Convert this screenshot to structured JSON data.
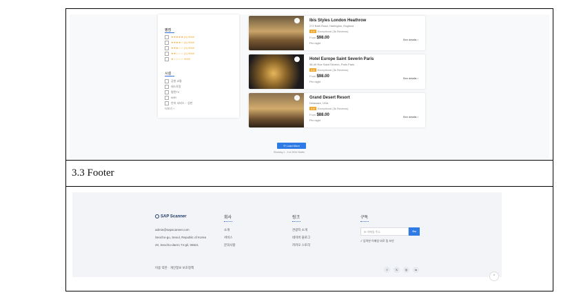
{
  "listing": {
    "filter_rating_title": "평점",
    "rating_items": [
      "★★★★★ (5) 9999",
      "★★★★☆ (4) 9999",
      "★★★☆☆ (3) 9999",
      "★★☆☆☆ (2) 9999",
      "★☆☆☆☆ 9999"
    ],
    "filter_facility_title": "시설",
    "facility_items": [
      "공항 교통",
      "레스토랑",
      "평면TV",
      "WiFi",
      "안마 서비스 ~ 상한"
    ],
    "facility_more": "더보기 +",
    "hotels": [
      {
        "name": "Ibis Styles London Heathrow",
        "address": "272 Bath Road, Harlington, England",
        "rating": "4.8",
        "rating_label": "Exceptional",
        "reviews": "(3k Reviews)",
        "price_prefix": "From",
        "price": "$98.00",
        "per": "Per night",
        "see": "See details ›"
      },
      {
        "name": "Hotel Europe Saint Severin Paris",
        "address": "38-40 Rue Saint Séverin, Paris Paris",
        "rating": "4.8",
        "rating_label": "Exceptional",
        "reviews": "(3k Reviews)",
        "price_prefix": "From",
        "price": "$98.00",
        "per": "Per night",
        "see": "See details ›"
      },
      {
        "name": "Grand Desert Resort",
        "address": "Delaware, USA",
        "rating": "4.8",
        "rating_label": "Exceptional",
        "reviews": "(3k Reviews)",
        "price_prefix": "From",
        "price": "$88.00",
        "per": "Per night",
        "see": "See details ›"
      }
    ],
    "load_more": "⟳ Load More",
    "showing": "Showing 1 - 9 of 2534 Hotels"
  },
  "section_heading": "3.3 Footer",
  "footer": {
    "logo": "SAP Scanner",
    "email": "admin@sapscanner.com",
    "addr1": "Seocho-gu, Seoul, Republic of Korea",
    "addr2": "20, Seocho-daero 74-gil, 06621",
    "col1_title": "회사",
    "col1_items": [
      "소개",
      "서비스",
      "문의사항"
    ],
    "col2_title": "링크",
    "col2_items": [
      "관광지 소개",
      "네이버 블로그",
      "카카오 스토리"
    ],
    "col3_title": "구독",
    "email_placeholder": "✉ 이메일 주소",
    "go": "Go",
    "subscribe_note": "✓ 입력한 이메일 외로 팀 보안",
    "legal": "이용 약관 · 개인정보 보호정책",
    "socials": [
      "f",
      "𝕏",
      "◎",
      "in"
    ],
    "to_top": "^"
  }
}
